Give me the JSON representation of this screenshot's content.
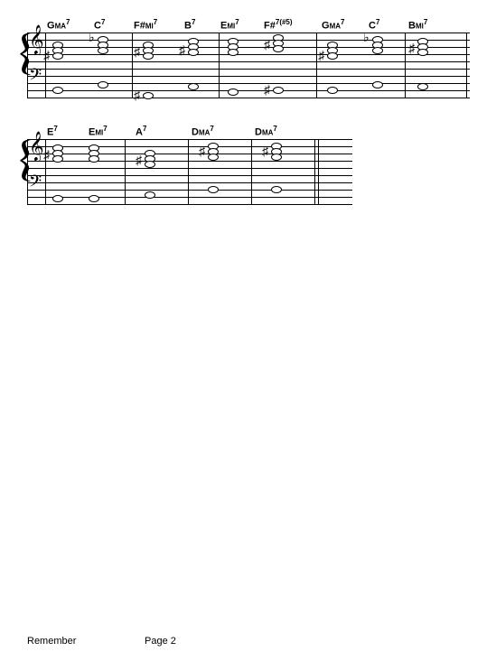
{
  "chart_data": {
    "type": "table",
    "title": "Remember",
    "page_label": "Page 2",
    "systems": [
      {
        "measures": [
          {
            "chords": [
              "Gma7",
              "C7"
            ]
          },
          {
            "chords": [
              "F#mi7",
              "B7"
            ]
          },
          {
            "chords": [
              "Emi7",
              "F#7(#5)"
            ]
          },
          {
            "chords": [
              "Gma7",
              "C7"
            ]
          },
          {
            "chords": [
              "Bmi7"
            ]
          }
        ]
      },
      {
        "measures": [
          {
            "chords": [
              "E7",
              "Emi7"
            ]
          },
          {
            "chords": [
              "A7"
            ]
          },
          {
            "chords": [
              "Dma7"
            ]
          },
          {
            "chords": [
              "Dma7"
            ]
          }
        ]
      }
    ]
  },
  "footer": {
    "title": "Remember",
    "page": "Page 2"
  },
  "s1": {
    "c0": {
      "root": "G",
      "qual": "MA",
      "ext": "7"
    },
    "c1": {
      "root": "C",
      "qual": "",
      "ext": "7"
    },
    "c2": {
      "root": "F",
      "acc": "#",
      "qual": "MI",
      "ext": "7"
    },
    "c3": {
      "root": "B",
      "qual": "",
      "ext": "7"
    },
    "c4": {
      "root": "E",
      "qual": "MI",
      "ext": "7"
    },
    "c5": {
      "root": "F",
      "acc": "#",
      "qual": "",
      "ext": "7",
      "alt": "(#5)"
    },
    "c6": {
      "root": "G",
      "qual": "MA",
      "ext": "7"
    },
    "c7": {
      "root": "C",
      "qual": "",
      "ext": "7"
    },
    "c8": {
      "root": "B",
      "qual": "MI",
      "ext": "7"
    }
  },
  "s2": {
    "c0": {
      "root": "E",
      "qual": "",
      "ext": "7"
    },
    "c1": {
      "root": "E",
      "qual": "MI",
      "ext": "7"
    },
    "c2": {
      "root": "A",
      "qual": "",
      "ext": "7"
    },
    "c3": {
      "root": "D",
      "qual": "MA",
      "ext": "7"
    },
    "c4": {
      "root": "D",
      "qual": "MA",
      "ext": "7"
    }
  }
}
